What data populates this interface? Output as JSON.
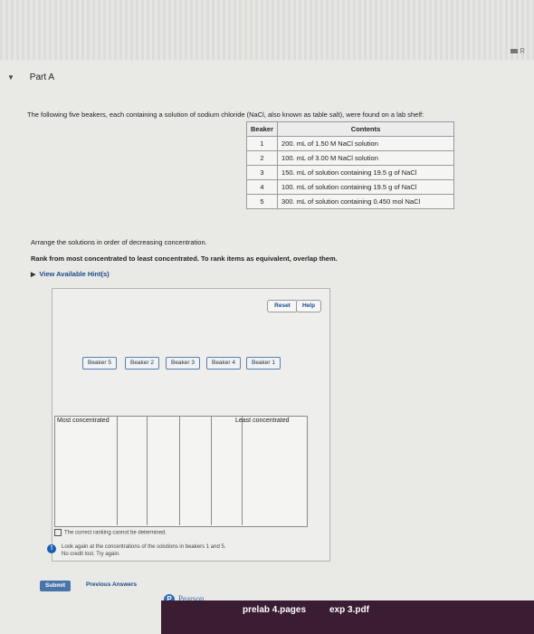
{
  "corner_text": "R",
  "part": {
    "title": "Part A"
  },
  "intro": "The following five beakers, each containing a solution of sodium chloride (NaCl, also known as table salt), were found on a lab shelf:",
  "table": {
    "headers": [
      "Beaker",
      "Contents"
    ],
    "rows": [
      {
        "beaker": "1",
        "contents": "200. mL of 1.50 M NaCl solution"
      },
      {
        "beaker": "2",
        "contents": "100. mL of 3.00 M NaCl solution"
      },
      {
        "beaker": "3",
        "contents": "150. mL of solution containing 19.5 g of NaCl"
      },
      {
        "beaker": "4",
        "contents": "100. mL of solution containing 19.5 g of NaCl"
      },
      {
        "beaker": "5",
        "contents": "300. mL of solution containing 0.450 mol NaCl"
      }
    ]
  },
  "instructions": {
    "line1": "Arrange the solutions in order of decreasing concentration.",
    "line2": "Rank from most concentrated to least concentrated. To rank items as equivalent, overlap them."
  },
  "hint_link": "View Available Hint(s)",
  "buttons": {
    "reset": "Reset",
    "help": "Help",
    "submit": "Submit",
    "previous_answers": "Previous Answers"
  },
  "chips": [
    "Beaker 5",
    "Beaker 2",
    "Beaker 3",
    "Beaker 4",
    "Beaker 1"
  ],
  "ranking": {
    "most": "Most concentrated",
    "least": "Least concentrated"
  },
  "feedback": {
    "check": "The correct ranking cannot be determined.",
    "info_line1": "Look again at the concentrations of the solutions in beakers 1 and 5.",
    "info_line2": "No credit lost. Try again."
  },
  "footer": {
    "brand": "Pearson",
    "dock_items": [
      "prelab 4.pages",
      "exp 3.pdf"
    ]
  }
}
